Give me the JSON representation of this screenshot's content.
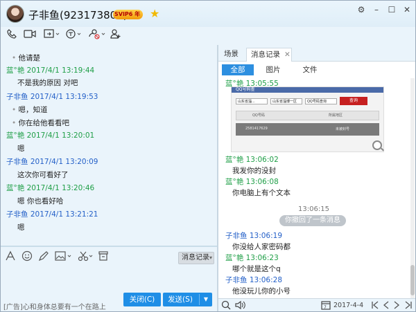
{
  "window": {
    "title": "子非鱼(923173805)",
    "badge": "SVIP6",
    "badge_suffix": "年",
    "controls": [
      "⚙",
      "–",
      "☐",
      "✕"
    ]
  },
  "toolbar": {
    "icons": [
      "phone-icon",
      "video-icon",
      "share-screen-icon",
      "remote-assist-icon",
      "file-transfer-icon",
      "add-member-icon"
    ]
  },
  "chat": {
    "messages": [
      {
        "type": "text",
        "text": "他请楚"
      },
      {
        "type": "header",
        "color": "green",
        "text": "蓝°艳 2017/4/1 13:19:44"
      },
      {
        "type": "text",
        "text": "不是我的原因 对吧"
      },
      {
        "type": "header",
        "color": "blue",
        "text": "子非鱼 2017/4/1 13:19:53"
      },
      {
        "type": "text",
        "text": "嗯，知道"
      },
      {
        "type": "text",
        "text": "你在给他看看吧"
      },
      {
        "type": "header",
        "color": "green",
        "text": "蓝°艳 2017/4/1 13:20:01"
      },
      {
        "type": "text",
        "text": "嗯"
      },
      {
        "type": "header",
        "color": "blue",
        "text": "子非鱼 2017/4/1 13:20:09"
      },
      {
        "type": "text",
        "text": "这次你可看好了"
      },
      {
        "type": "header",
        "color": "green",
        "text": "蓝°艳 2017/4/1 13:20:46"
      },
      {
        "type": "text",
        "text": "嗯 你也看好哈"
      },
      {
        "type": "header",
        "color": "blue",
        "text": "子非鱼 2017/4/1 13:21:21"
      },
      {
        "type": "text",
        "text": "嗯"
      }
    ]
  },
  "format_bar": {
    "history_label": "消息记录"
  },
  "input": {
    "ad_text": "[广告]心和身体总要有一个在路上",
    "close_label": "关闭(C)",
    "send_label": "发送(S)"
  },
  "right": {
    "tabs": [
      "场景",
      "消息记录"
    ],
    "subtabs": [
      "全部",
      "图片",
      "文件"
    ],
    "image_sender": "蓝°艳 13:05:55",
    "image_text": {
      "top_label": "QQ号码查",
      "row1": [
        "山东省淄...",
        "山东省淄博一区",
        "QQ号码查询",
        "查询"
      ],
      "row2": [
        "QQ号码",
        "所属地区"
      ],
      "row3": [
        "2581417629",
        "未被封号"
      ]
    },
    "messages": [
      {
        "sender": "蓝°艳 13:06:02",
        "color": "green",
        "text": "我发你的没封"
      },
      {
        "sender": "蓝°艳 13:06:08",
        "color": "green",
        "text": "你电脑上有个文本"
      }
    ],
    "recall_time": "13:06:15",
    "recall_text": "你撤回了一条消息",
    "messages2": [
      {
        "sender": "子非鱼 13:06:19",
        "color": "blue",
        "text": "你没给人家密码都"
      },
      {
        "sender": "蓝°艳 13:06:23",
        "color": "green",
        "text": "哪个就是这个q"
      },
      {
        "sender": "子非鱼 13:06:28",
        "color": "blue",
        "text": "他没玩儿你的小号"
      }
    ],
    "date": "2017-4-4"
  },
  "colors": {
    "green": "#1e9e46",
    "blue": "#2460c8",
    "accent": "#1f8ee6"
  }
}
